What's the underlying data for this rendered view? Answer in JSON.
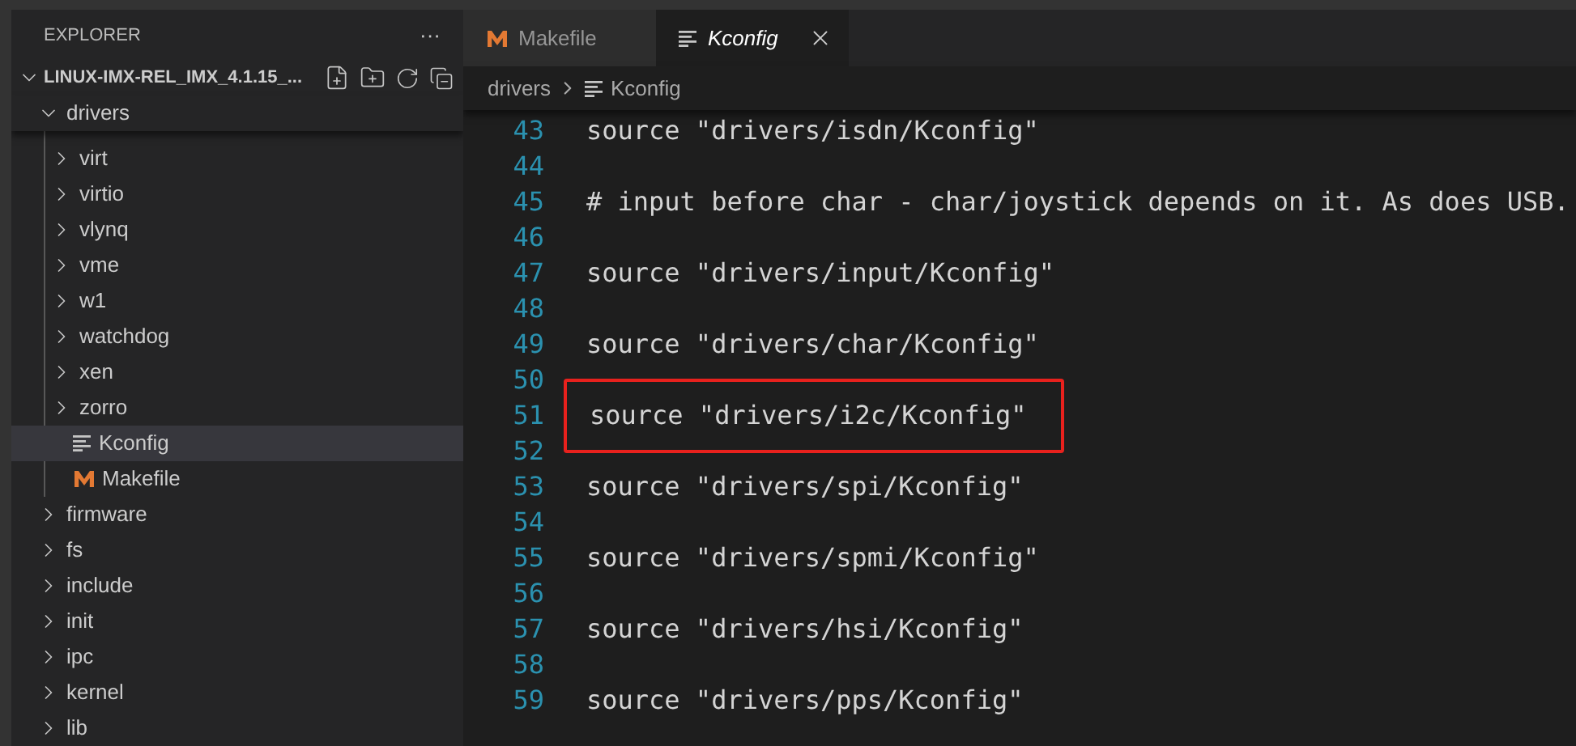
{
  "sidebar": {
    "title": "EXPLORER",
    "more": "···",
    "root": {
      "label": "LINUX-IMX-REL_IMX_4.1.15_...",
      "expanded": true,
      "children": [
        {
          "label": "drivers",
          "kind": "folder",
          "expanded": true,
          "selected": false,
          "children": [
            {
              "label": "virt",
              "kind": "folder",
              "expanded": false,
              "selected": false
            },
            {
              "label": "virtio",
              "kind": "folder",
              "expanded": false,
              "selected": false
            },
            {
              "label": "vlynq",
              "kind": "folder",
              "expanded": false,
              "selected": false
            },
            {
              "label": "vme",
              "kind": "folder",
              "expanded": false,
              "selected": false
            },
            {
              "label": "w1",
              "kind": "folder",
              "expanded": false,
              "selected": false
            },
            {
              "label": "watchdog",
              "kind": "folder",
              "expanded": false,
              "selected": false
            },
            {
              "label": "xen",
              "kind": "folder",
              "expanded": false,
              "selected": false
            },
            {
              "label": "zorro",
              "kind": "folder",
              "expanded": false,
              "selected": false
            },
            {
              "label": "Kconfig",
              "kind": "config",
              "selected": true
            },
            {
              "label": "Makefile",
              "kind": "makefile",
              "selected": false
            }
          ]
        },
        {
          "label": "firmware",
          "kind": "folder",
          "expanded": false,
          "selected": false
        },
        {
          "label": "fs",
          "kind": "folder",
          "expanded": false,
          "selected": false
        },
        {
          "label": "include",
          "kind": "folder",
          "expanded": false,
          "selected": false
        },
        {
          "label": "init",
          "kind": "folder",
          "expanded": false,
          "selected": false
        },
        {
          "label": "ipc",
          "kind": "folder",
          "expanded": false,
          "selected": false
        },
        {
          "label": "kernel",
          "kind": "folder",
          "expanded": false,
          "selected": false
        },
        {
          "label": "lib",
          "kind": "folder",
          "expanded": false,
          "selected": false
        }
      ]
    }
  },
  "tabs": [
    {
      "label": "Makefile",
      "kind": "makefile",
      "selected": false,
      "preview": false
    },
    {
      "label": "Kconfig",
      "kind": "config",
      "selected": true,
      "preview": true
    }
  ],
  "breadcrumb": [
    {
      "label": "drivers",
      "kind": "folder"
    },
    {
      "label": "Kconfig",
      "kind": "config"
    }
  ],
  "editor": {
    "lines": [
      {
        "number": "43",
        "text": "source \"drivers/isdn/Kconfig\"",
        "highlighted": false
      },
      {
        "number": "44",
        "highlighted": false
      },
      {
        "number": "45",
        "text": "# input before char - char/joystick depends on it. As does USB.",
        "highlighted": false
      },
      {
        "number": "46",
        "highlighted": false
      },
      {
        "number": "47",
        "text": "source \"drivers/input/Kconfig\"",
        "highlighted": false
      },
      {
        "number": "48",
        "highlighted": false
      },
      {
        "number": "49",
        "text": "source \"drivers/char/Kconfig\"",
        "highlighted": false
      },
      {
        "number": "50",
        "highlighted": false
      },
      {
        "number": "51",
        "text": "source \"drivers/i2c/Kconfig\"",
        "highlighted": true
      },
      {
        "number": "52",
        "highlighted": false
      },
      {
        "number": "53",
        "text": "source \"drivers/spi/Kconfig\"",
        "highlighted": false
      },
      {
        "number": "54",
        "highlighted": false
      },
      {
        "number": "55",
        "text": "source \"drivers/spmi/Kconfig\"",
        "highlighted": false
      },
      {
        "number": "56",
        "highlighted": false
      },
      {
        "number": "57",
        "text": "source \"drivers/hsi/Kconfig\"",
        "highlighted": false
      },
      {
        "number": "58",
        "highlighted": false
      },
      {
        "number": "59",
        "text": "source \"drivers/pps/Kconfig\"",
        "highlighted": false
      }
    ]
  }
}
